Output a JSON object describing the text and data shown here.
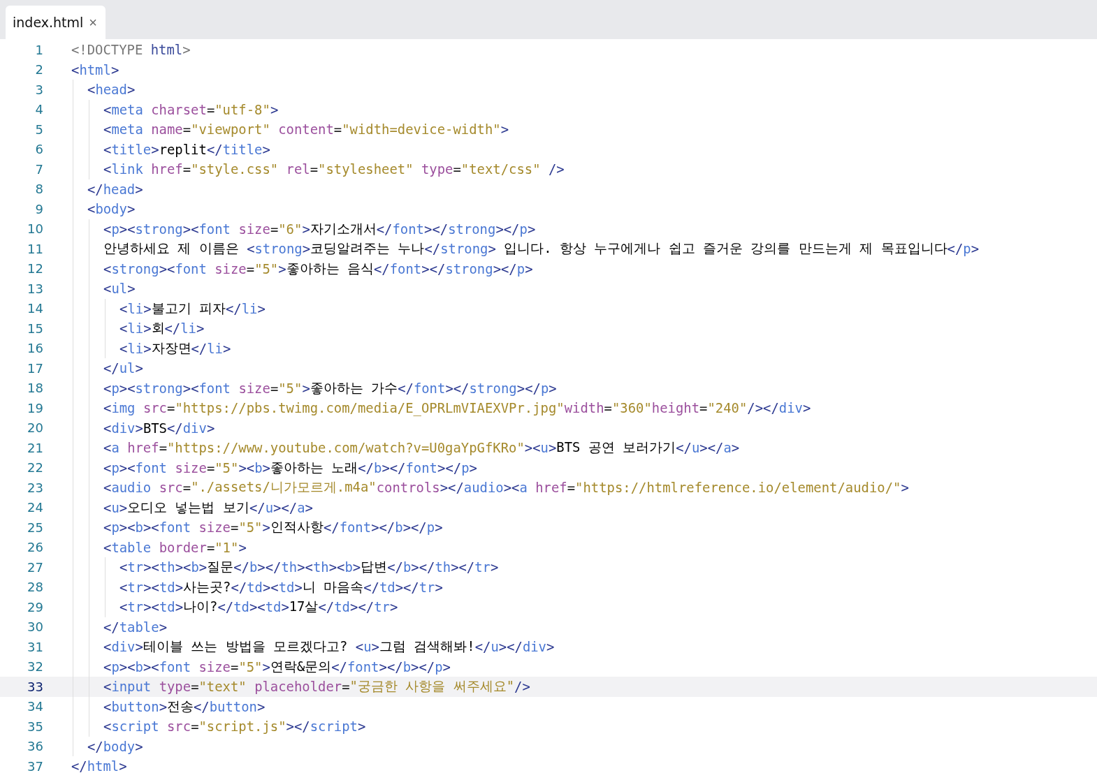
{
  "tab": {
    "label": "index.html",
    "close": "×",
    "selected": true
  },
  "lines": [
    {
      "number": "1",
      "code": "<!DOCTYPE html>",
      "active": false
    },
    {
      "number": "2",
      "code": "<html>",
      "active": false,
      "children": [
        {
          "number": "3",
          "code": "<head>",
          "active": false,
          "children": [
            {
              "number": "4",
              "code": "<meta charset=\"utf-8\">",
              "active": false
            },
            {
              "number": "5",
              "code": "<meta name=\"viewport\" content=\"width=device-width\">",
              "active": false
            },
            {
              "number": "6",
              "code": "<title>replit</title>",
              "active": false
            },
            {
              "number": "7",
              "code": "<link href=\"style.css\" rel=\"stylesheet\" type=\"text/css\" />",
              "active": false
            }
          ]
        },
        {
          "number": "8",
          "code": "</head>",
          "active": false
        },
        {
          "number": "9",
          "code": "<body>",
          "active": false,
          "children": [
            {
              "number": "10",
              "code": "<p><strong><font size=\"6\">자기소개서</font></strong></p>",
              "active": false
            },
            {
              "number": "11",
              "code": "안녕하세요 제 이름은 <strong>코딩알려주는 누나</strong> 입니다. 항상 누구에게나 쉽고 즐거운 강의를 만드는게 제 목표입니다</p>",
              "active": false
            },
            {
              "number": "12",
              "code": "<strong><font size=\"5\">좋아하는 음식</font></strong></p>",
              "active": false
            },
            {
              "number": "13",
              "code": "<ul>",
              "active": false,
              "children": [
                {
                  "number": "14",
                  "code": "<li>불고기 피자</li>",
                  "active": false
                },
                {
                  "number": "15",
                  "code": "<li>회</li>",
                  "active": false
                },
                {
                  "number": "16",
                  "code": "<li>자장면</li>",
                  "active": false
                }
              ]
            },
            {
              "number": "17",
              "code": "</ul>",
              "active": false
            },
            {
              "number": "18",
              "code": "<p><strong><font size=\"5\">좋아하는 가수</font></strong></p>",
              "active": false
            },
            {
              "number": "19",
              "code": "<img src=\"https://pbs.twimg.com/media/E_OPRLmVIAEXVPr.jpg\"width=\"360\"height=\"240\"/></div>",
              "active": false
            },
            {
              "number": "20",
              "code": "<div>BTS</div>",
              "active": false
            },
            {
              "number": "21",
              "code": "<a href=\"https://www.youtube.com/watch?v=U0gaYpGfKRo\"><u>BTS 공연 보러가기</u></a>",
              "active": false
            },
            {
              "number": "22",
              "code": "<p><font size=\"5\"><b>좋아하는 노래</b></font></p>",
              "active": false
            },
            {
              "number": "23",
              "code": "<audio src=\"./assets/니가모르게.m4a\"controls></audio><a href=\"https://htmlreference.io/element/audio/\">",
              "active": false
            },
            {
              "number": "24",
              "code": "<u>오디오 넣는법 보기</u></a>",
              "active": false
            },
            {
              "number": "25",
              "code": "<p><b><font size=\"5\">인적사항</font></b></p>",
              "active": false
            },
            {
              "number": "26",
              "code": "<table border=\"1\">",
              "active": false,
              "children": [
                {
                  "number": "27",
                  "code": "<tr><th><b>질문</b></th><th><b>답변</b></th></tr>",
                  "active": false
                },
                {
                  "number": "28",
                  "code": "<tr><td>사는곳?</td><td>니 마음속</td></tr>",
                  "active": false
                },
                {
                  "number": "29",
                  "code": "<tr><td>나이?</td><td>17살</td></tr>",
                  "active": false
                }
              ]
            },
            {
              "number": "30",
              "code": "</table>",
              "active": false
            },
            {
              "number": "31",
              "code": "<div>테이블 쓰는 방법을 모르겠다고? <u>그럼 검색해봐!</u></div>",
              "active": false
            },
            {
              "number": "32",
              "code": "<p><b><font size=\"5\">연락&문의</font></b></p>",
              "active": false
            },
            {
              "number": "33",
              "code": "<input type=\"text\" placeholder=\"궁금한 사항을 써주세요\"/>",
              "active": true
            },
            {
              "number": "34",
              "code": "<button>전송</button>",
              "active": false
            },
            {
              "number": "35",
              "code": "<script src=\"script.js\"></script>",
              "active": false
            }
          ]
        },
        {
          "number": "36",
          "code": "</body>",
          "active": false
        }
      ]
    },
    {
      "number": "37",
      "code": "</html>",
      "active": false
    }
  ]
}
